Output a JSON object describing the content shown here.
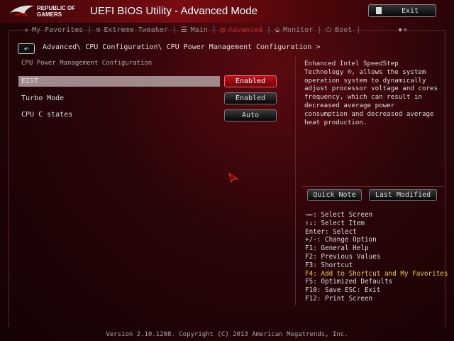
{
  "header": {
    "brand_line1": "REPUBLIC OF",
    "brand_line2": "GAMERS",
    "title": "UEFI BIOS Utility - Advanced Mode",
    "exit_label": "Exit"
  },
  "tabs": [
    {
      "label": "My Favorites",
      "icon": "star-icon"
    },
    {
      "label": "Extreme Tweaker",
      "icon": "tweaker-icon"
    },
    {
      "label": "Main",
      "icon": "list-icon"
    },
    {
      "label": "Advanced",
      "icon": "advanced-icon",
      "active": true
    },
    {
      "label": "Monitor",
      "icon": "monitor-icon"
    },
    {
      "label": "Boot",
      "icon": "power-icon"
    }
  ],
  "breadcrumb": "Advanced\\ CPU Configuration\\ CPU Power Management Configuration >",
  "section_title": "CPU Power Management Configuration",
  "settings": [
    {
      "label": "EIST",
      "value": "Enabled"
    },
    {
      "label": "Turbo Mode",
      "value": "Enabled"
    },
    {
      "label": "CPU C states",
      "value": "Auto"
    }
  ],
  "help_text": "Enhanced Intel SpeedStep Technology ®, allows the system operation system to dynamically adjust processor voltage and cores frequency, which can result in decreased average power consumption and decreased average heat production.",
  "buttons": {
    "quick_note": "Quick Note",
    "last_modified": "Last Modified"
  },
  "keys": [
    "→←: Select Screen",
    "↑↓: Select Item",
    "Enter: Select",
    "+/-: Change Option",
    "F1: General Help",
    "F2: Previous Values",
    "F3: Shortcut",
    "F4: Add to Shortcut and My Favorites",
    "F5: Optimized Defaults",
    "F10: Save  ESC: Exit",
    "F12: Print Screen"
  ],
  "footer": "Version 2.10.1208. Copyright (C) 2013 American Megatrends, Inc.",
  "colors": {
    "accent": "#e0201e",
    "highlight_key": "#e8d020"
  }
}
